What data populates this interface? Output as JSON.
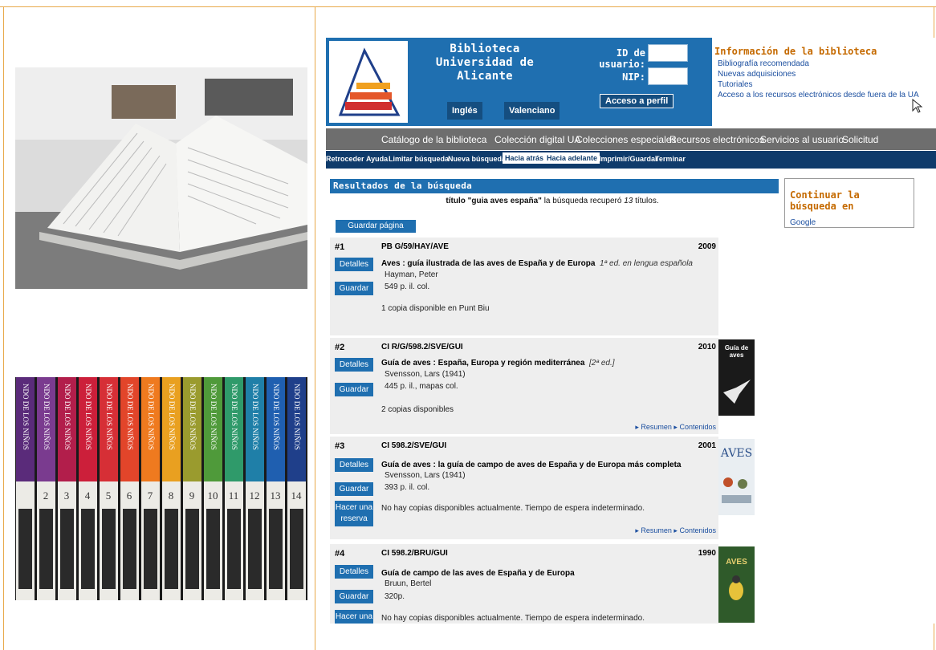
{
  "left_panel": {
    "spine_numbers": [
      "2",
      "3",
      "4",
      "5",
      "6",
      "7",
      "8",
      "9",
      "10",
      "11",
      "12",
      "13",
      "14"
    ],
    "spine_title": "NDO DE LOS NIÑOS",
    "spine_colors": [
      "#5a2b7a",
      "#7a3b8f",
      "#b21e4b",
      "#cc1f3a",
      "#d62f36",
      "#e2452a",
      "#ef7a1f",
      "#e9a020",
      "#9a9b2e",
      "#4f9a3a",
      "#2f9a6a",
      "#1f7fa8",
      "#1f5fb0",
      "#1f3f8a"
    ]
  },
  "header": {
    "title_line1": "Biblioteca",
    "title_line2": "Universidad de Alicante",
    "lang_english": "Inglés",
    "lang_valencian": "Valenciano",
    "user_id_label": "ID de usuario:",
    "pin_label": "NIP:",
    "profile_button": "Acceso a perfil"
  },
  "info_panel": {
    "title": "Información de la biblioteca",
    "links": [
      "Bibliografía recomendada",
      "Nuevas adquisiciones",
      "Tutoriales",
      "Acceso a los recursos electrónicos desde fuera de la UA"
    ]
  },
  "nav_main": [
    "Catálogo de la biblioteca",
    "Colección digital UA",
    "Colecciones especiales",
    "Recursos electrónicos",
    "Servicios al usuario",
    "Solicitud"
  ],
  "nav_secondary": [
    "Retroceder",
    "Ayuda",
    "Limitar búsqueda",
    "Nueva búsqueda",
    "Hacia atrás",
    "Hacia adelante",
    "Imprimir/Guardar",
    "Terminar"
  ],
  "results": {
    "heading": "Resultados de la búsqueda",
    "summary_field": "título",
    "summary_query": "\"guia aves españa\"",
    "summary_mid": "la búsqueda recuperó",
    "summary_count": "13",
    "summary_tail": "títulos.",
    "save_page": "Guardar página"
  },
  "continue_search": {
    "title": "Continuar la búsqueda en",
    "link": "Google"
  },
  "records": [
    {
      "num": "#1",
      "call": "PB G/59/HAY/AVE",
      "year": "2009",
      "title": "Aves : guía ilustrada de las aves de España y de Europa",
      "edition": "1ª ed. en lengua española",
      "author": "Hayman, Peter",
      "physical": "549 p. il. col.",
      "availability": "1 copia disponible en Punt Biu",
      "btn_details": "Detalles",
      "btn_save": "Guardar"
    },
    {
      "num": "#2",
      "call": "CI R/G/598.2/SVE/GUI",
      "year": "2010",
      "title": "Guía de aves : España, Europa y región mediterránea",
      "edition": "[2ª ed.]",
      "author": "Svensson, Lars (1941)",
      "physical": "445 p. il., mapas col.",
      "availability": "2 copias disponibles",
      "btn_details": "Detalles",
      "btn_save": "Guardar",
      "link_summary": "Resumen",
      "link_contents": "Contenidos",
      "cover_text": "Guía de aves"
    },
    {
      "num": "#3",
      "call": "CI 598.2/SVE/GUI",
      "year": "2001",
      "title": "Guía de aves : la guía de campo de aves de España y de Europa más completa",
      "author": "Svensson, Lars (1941)",
      "physical": "393 p. il. col.",
      "availability": "No hay copias disponibles actualmente. Tiempo de espera indeterminado.",
      "btn_details": "Detalles",
      "btn_save": "Guardar",
      "btn_reserve_line1": "Hacer una",
      "btn_reserve_line2": "reserva",
      "link_summary": "Resumen",
      "link_contents": "Contenidos",
      "cover_text": "AVES"
    },
    {
      "num": "#4",
      "call": "CI 598.2/BRU/GUI",
      "year": "1990",
      "title": "Guía de campo de las aves de España y de Europa",
      "author": "Bruun, Bertel",
      "physical": "320p.",
      "availability": "No hay copias disponibles actualmente. Tiempo de espera indeterminado.",
      "btn_details": "Detalles",
      "btn_save": "Guardar",
      "btn_reserve_line1": "Hacer una",
      "cover_text": "AVES"
    }
  ]
}
